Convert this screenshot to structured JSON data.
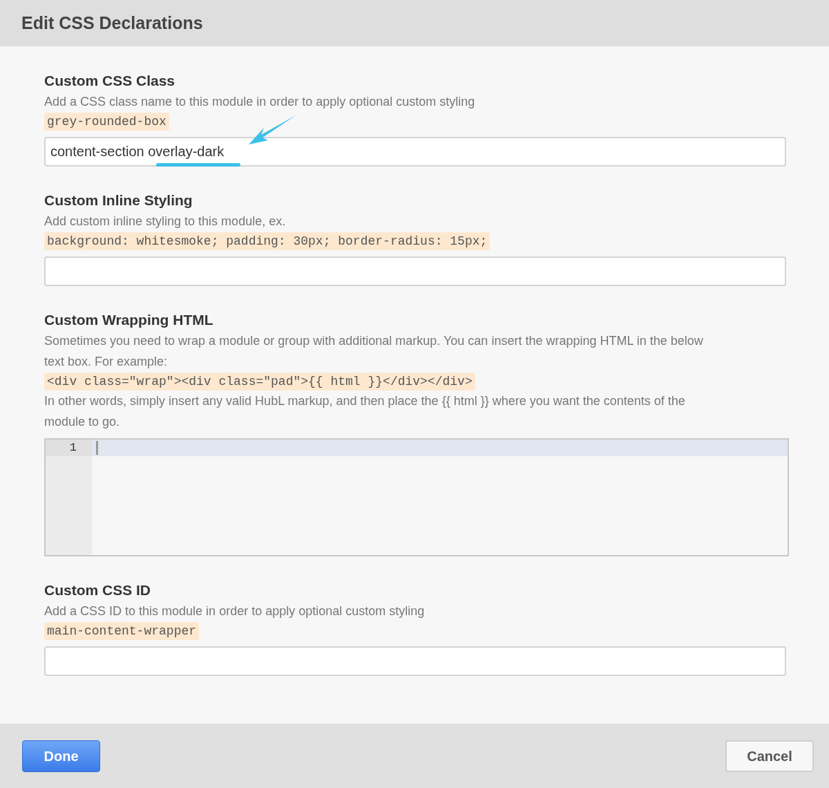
{
  "window": {
    "title": "Edit CSS Declarations"
  },
  "sections": [
    {
      "kind": "input",
      "heading": "Custom CSS Class",
      "description": "Add a CSS class name to this module in order to apply optional custom styling",
      "example": "grey-rounded-box",
      "value": "content-section overlay-dark"
    },
    {
      "kind": "input",
      "heading": "Custom Inline Styling",
      "description": "Add custom inline styling to this module, ex.",
      "example": "background: whitesmoke; padding: 30px; border-radius: 15px;"
    },
    {
      "kind": "code_editor",
      "heading": "Custom Wrapping HTML",
      "description": "Sometimes you need to wrap a module or group with additional markup. You can insert the wrapping HTML in the below text box. For example:",
      "example": "<div class=\"wrap\"><div class=\"pad\">{{ html }}</div></div>",
      "note": "In other words, simply insert any valid HubL markup, and then place the {{ html }} where you want the contents of the module to go.",
      "line_numbers": [
        "1"
      ]
    },
    {
      "kind": "input",
      "heading": "Custom CSS ID",
      "description": "Add a CSS ID to this module in order to apply optional custom styling",
      "example": "main-content-wrapper"
    }
  ],
  "buttons": {
    "primary": "Done",
    "secondary": "Cancel"
  }
}
